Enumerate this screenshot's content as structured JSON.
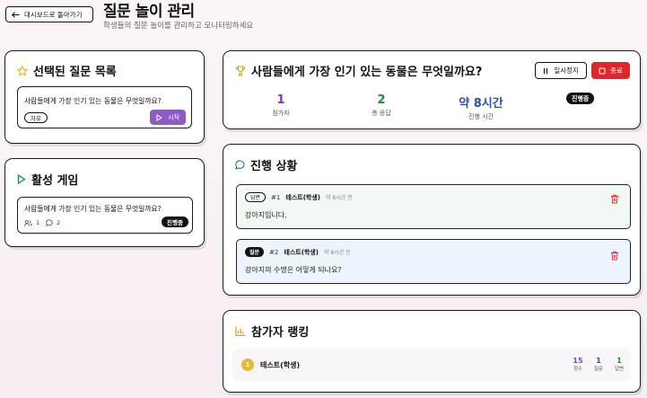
{
  "header": {
    "back_label": "대시보드로 돌아가기",
    "title": "질문 놀이 관리",
    "subtitle": "학생들의 질문 놀이를 관리하고 모니터링하세요"
  },
  "selected": {
    "title": "선택된 질문 목록",
    "question": "사람들에게 가장 인기 있는 동물은 무엇일까요?",
    "badge": "자유",
    "start_label": "시작"
  },
  "active": {
    "title": "활성 게임",
    "question": "사람들에게 가장 인기 있는 동물은 무엇일까요?",
    "participants": "1",
    "messages": "2",
    "status": "진행중"
  },
  "game": {
    "title": "사람들에게 가장 인기 있는 동물은 무엇일까요?",
    "pause_label": "일시정지",
    "end_label": "종료",
    "status": "진행중",
    "stats": [
      {
        "value": "1",
        "label": "참가자",
        "color": "#7b3fb0"
      },
      {
        "value": "2",
        "label": "총 응답",
        "color": "#1d8a3e"
      },
      {
        "value": "약 8시간",
        "label": "진행 시간",
        "color": "#2a4fae"
      }
    ]
  },
  "progress": {
    "title": "진행 상황",
    "messages": [
      {
        "type": "답변",
        "num": "#1",
        "author": "테스트(학생)",
        "time": "약 8시간 전",
        "text": "강아지입니다.",
        "bg": "#f2f8f2"
      },
      {
        "type": "질문",
        "num": "#2",
        "author": "테스트(학생)",
        "time": "약 8시간 전",
        "text": "강아지의 수명은 어떻게 되나요?",
        "bg": "#eef4fc"
      }
    ]
  },
  "ranking": {
    "title": "참가자 랭킹",
    "rows": [
      {
        "rank": "1",
        "name": "테스트(학생)",
        "stats": [
          {
            "value": "15",
            "label": "점수",
            "color": "#7b3fb0"
          },
          {
            "value": "1",
            "label": "질문",
            "color": "#2a4fae"
          },
          {
            "value": "1",
            "label": "답변",
            "color": "#1d8a3e"
          }
        ]
      }
    ]
  },
  "colors": {
    "accent": "#8d5cc1",
    "danger": "#e0262b",
    "star": "#e5b400",
    "trophy": "#d6a000"
  }
}
